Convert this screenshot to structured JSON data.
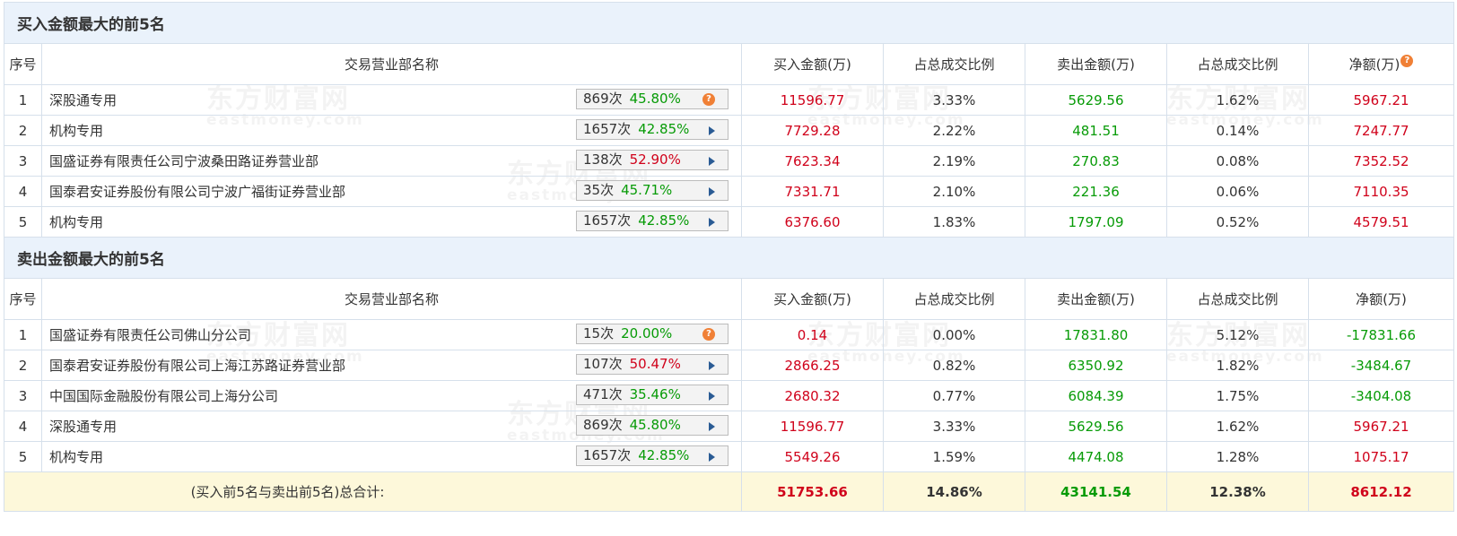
{
  "watermark": {
    "cn": "东方财富网",
    "en": "eastmoney.com"
  },
  "sections": [
    {
      "title": "买入金额最大的前5名",
      "headers": {
        "idx": "序号",
        "name": "交易营业部名称",
        "buy": "买入金额(万)",
        "buy_ratio": "占总成交比例",
        "sell": "卖出金额(万)",
        "sell_ratio": "占总成交比例",
        "net": "净额(万)"
      },
      "rows": [
        {
          "idx": "1",
          "name": "深股通专用",
          "count": "869次",
          "pct": "45.80%",
          "pct_color": "green",
          "icon": "help-icon",
          "buy": "11596.77",
          "buy_ratio": "3.33%",
          "sell": "5629.56",
          "sell_ratio": "1.62%",
          "net": "5967.21"
        },
        {
          "idx": "2",
          "name": "机构专用",
          "count": "1657次",
          "pct": "42.85%",
          "pct_color": "green",
          "icon": "arrow-right-icon",
          "buy": "7729.28",
          "buy_ratio": "2.22%",
          "sell": "481.51",
          "sell_ratio": "0.14%",
          "net": "7247.77"
        },
        {
          "idx": "3",
          "name": "国盛证券有限责任公司宁波桑田路证券营业部",
          "count": "138次",
          "pct": "52.90%",
          "pct_color": "red",
          "icon": "arrow-right-icon",
          "buy": "7623.34",
          "buy_ratio": "2.19%",
          "sell": "270.83",
          "sell_ratio": "0.08%",
          "net": "7352.52"
        },
        {
          "idx": "4",
          "name": "国泰君安证券股份有限公司宁波广福街证券营业部",
          "count": "35次",
          "pct": "45.71%",
          "pct_color": "green",
          "icon": "arrow-right-icon",
          "buy": "7331.71",
          "buy_ratio": "2.10%",
          "sell": "221.36",
          "sell_ratio": "0.06%",
          "net": "7110.35"
        },
        {
          "idx": "5",
          "name": "机构专用",
          "count": "1657次",
          "pct": "42.85%",
          "pct_color": "green",
          "icon": "arrow-right-icon",
          "buy": "6376.60",
          "buy_ratio": "1.83%",
          "sell": "1797.09",
          "sell_ratio": "0.52%",
          "net": "4579.51"
        }
      ]
    },
    {
      "title": "卖出金额最大的前5名",
      "headers": {
        "idx": "序号",
        "name": "交易营业部名称",
        "buy": "买入金额(万)",
        "buy_ratio": "占总成交比例",
        "sell": "卖出金额(万)",
        "sell_ratio": "占总成交比例",
        "net": "净额(万)"
      },
      "rows": [
        {
          "idx": "1",
          "name": "国盛证券有限责任公司佛山分公司",
          "count": "15次",
          "pct": "20.00%",
          "pct_color": "green",
          "icon": "help-icon",
          "buy": "0.14",
          "buy_ratio": "0.00%",
          "sell": "17831.80",
          "sell_ratio": "5.12%",
          "net": "-17831.66"
        },
        {
          "idx": "2",
          "name": "国泰君安证券股份有限公司上海江苏路证券营业部",
          "count": "107次",
          "pct": "50.47%",
          "pct_color": "red",
          "icon": "arrow-right-icon",
          "buy": "2866.25",
          "buy_ratio": "0.82%",
          "sell": "6350.92",
          "sell_ratio": "1.82%",
          "net": "-3484.67"
        },
        {
          "idx": "3",
          "name": "中国国际金融股份有限公司上海分公司",
          "count": "471次",
          "pct": "35.46%",
          "pct_color": "green",
          "icon": "arrow-right-icon",
          "buy": "2680.32",
          "buy_ratio": "0.77%",
          "sell": "6084.39",
          "sell_ratio": "1.75%",
          "net": "-3404.08"
        },
        {
          "idx": "4",
          "name": "深股通专用",
          "count": "869次",
          "pct": "45.80%",
          "pct_color": "green",
          "icon": "arrow-right-icon",
          "buy": "11596.77",
          "buy_ratio": "3.33%",
          "sell": "5629.56",
          "sell_ratio": "1.62%",
          "net": "5967.21"
        },
        {
          "idx": "5",
          "name": "机构专用",
          "count": "1657次",
          "pct": "42.85%",
          "pct_color": "green",
          "icon": "arrow-right-icon",
          "buy": "5549.26",
          "buy_ratio": "1.59%",
          "sell": "4474.08",
          "sell_ratio": "1.28%",
          "net": "1075.17"
        }
      ]
    }
  ],
  "total": {
    "label": "(买入前5名与卖出前5名)总合计:",
    "buy": "51753.66",
    "buy_ratio": "14.86%",
    "sell": "43141.54",
    "sell_ratio": "12.38%",
    "net": "8612.12"
  },
  "colors": {
    "red": "#d0021b",
    "green": "#079b07",
    "header_bg": "#eaf2fb",
    "total_bg": "#fdf8da",
    "border": "#d6e0eb",
    "icon_orange": "#f08036",
    "arrow_blue": "#2a5b94"
  }
}
